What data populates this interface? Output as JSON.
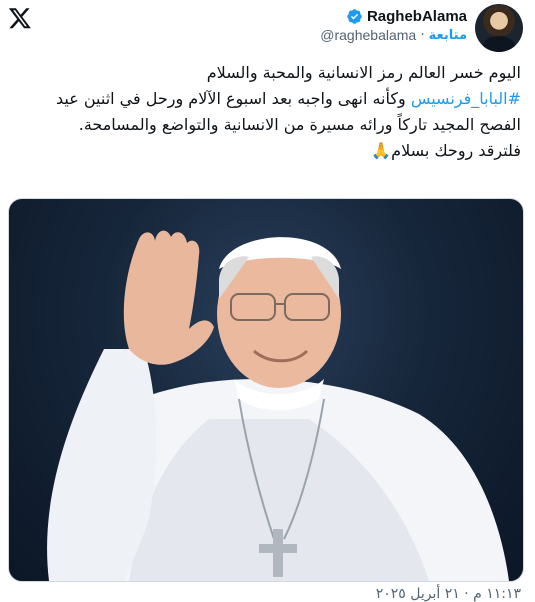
{
  "app": {
    "logo_icon": "x-logo-icon"
  },
  "author": {
    "display_name": "RaghebAlama",
    "handle": "@raghebalama",
    "separator": "·",
    "follow_label": "متابعة",
    "verified_color": "#1d9bf0"
  },
  "tweet": {
    "line1": "اليوم خسر العالم رمز الانسانية والمحبة والسلام",
    "hashtag": "#البابا_فرنسيس",
    "line2_rest": " وكأنه انهى واجبه بعد اسبوع الآلام ورحل في اثنين عيد الفصح المجيد تاركاً ورائه مسيرة من الانسانية والتواضع والمسامحة.",
    "line3": "فلترقد روحك بسلام🙏",
    "timestamp": "١١:١٣ م · ٢١ أبريل ٢٠٢٥"
  },
  "media": {
    "icon": "photo-pope-francis-waving"
  }
}
